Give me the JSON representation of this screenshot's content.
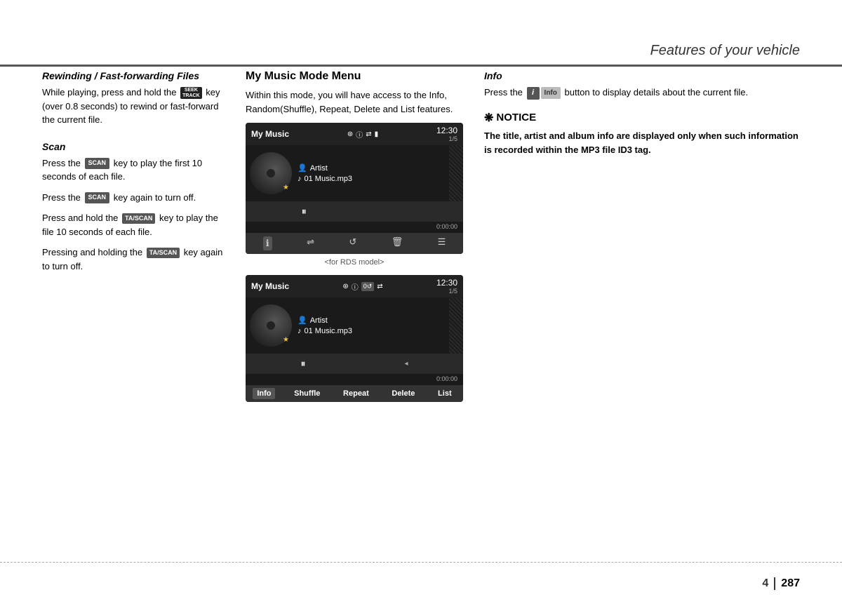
{
  "header": {
    "title": "Features of your vehicle"
  },
  "footer": {
    "chapter": "4",
    "page": "287"
  },
  "left_col": {
    "section1_title": "Rewinding / Fast-forwarding Files",
    "section1_body": "While playing, press and hold the",
    "section1_seek_label_top": "SEEK",
    "section1_seek_label_bottom": "TRACK",
    "section1_body2": "key (over 0.8 seconds) to rewind or fast-forward the current file.",
    "section2_title": "Scan",
    "section2_p1a": "Press the",
    "section2_scan1": "SCAN",
    "section2_p1b": "key to play the first 10 seconds of each file.",
    "section2_p2a": "Press the",
    "section2_scan2": "SCAN",
    "section2_p2b": "key again to turn off.",
    "section2_p3a": "Press and hold the",
    "section2_tascan1": "TA/SCAN",
    "section2_p3b": "key to play the file 10 seconds of each file.",
    "section2_p4a": "Pressing and holding the",
    "section2_tascan2": "TA/SCAN",
    "section2_p4b": "key again to turn off."
  },
  "mid_col": {
    "section_title": "My Music Mode Menu",
    "body": "Within this mode, you will have access to the Info, Random(Shuffle), Repeat, Delete and List features.",
    "screen1": {
      "title": "My Music",
      "time": "12:30",
      "track_num": "1/5",
      "artist": "Artist",
      "filename": "01 Music.mp3",
      "time_display": "0:00:00"
    },
    "caption1": "<for RDS model>",
    "screen2": {
      "title": "My Music",
      "time": "12:30",
      "track_num": "1/5",
      "artist": "Artist",
      "filename": "01 Music.mp3",
      "time_display": "0:00:00"
    },
    "menu_buttons": [
      "Info",
      "Shuffle",
      "Repeat",
      "Delete",
      "List"
    ]
  },
  "right_col": {
    "section_title": "Info",
    "body_p1a": "Press the",
    "info_icon_label": "i",
    "info_btn_label": "Info",
    "body_p1b": "button to display details about the current file.",
    "notice_title": "NOTICE",
    "notice_star": "❋",
    "notice_text": "The title, artist and album info are displayed only when such information is recorded within the MP3 file ID3 tag."
  }
}
